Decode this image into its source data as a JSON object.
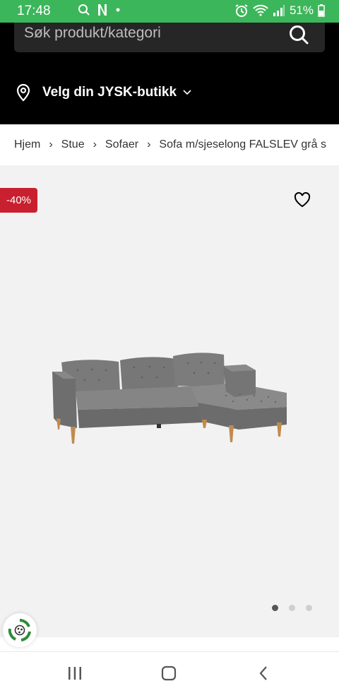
{
  "status": {
    "time": "17:48",
    "battery": "51%"
  },
  "search": {
    "placeholder": "Søk produkt/kategori"
  },
  "store": {
    "label": "Velg din JYSK-butikk"
  },
  "breadcrumb": {
    "items": [
      "Hjem",
      "Stue",
      "Sofaer",
      "Sofa m/sjeselong FALSLEV grå s"
    ]
  },
  "product": {
    "discount_badge": "-40%",
    "image_count": 3,
    "active_image": 1
  },
  "colors": {
    "status_bar": "#3cb65a",
    "header": "#000000",
    "discount": "#c8202f"
  }
}
